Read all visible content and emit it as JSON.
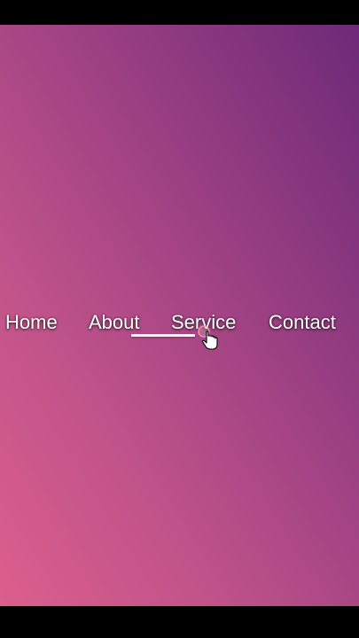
{
  "nav": {
    "items": [
      {
        "label": "Home"
      },
      {
        "label": "About"
      },
      {
        "label": "Service"
      },
      {
        "label": "Contact"
      }
    ],
    "active_underline_state": "animating between About and Service"
  },
  "colors": {
    "gradient_bottom_left": "#dc5f8c",
    "gradient_top_right": "#6d2a78",
    "letterbox": "#000000",
    "text": "#ffffff"
  },
  "cursor": {
    "icon": "hand-pointer-icon"
  }
}
